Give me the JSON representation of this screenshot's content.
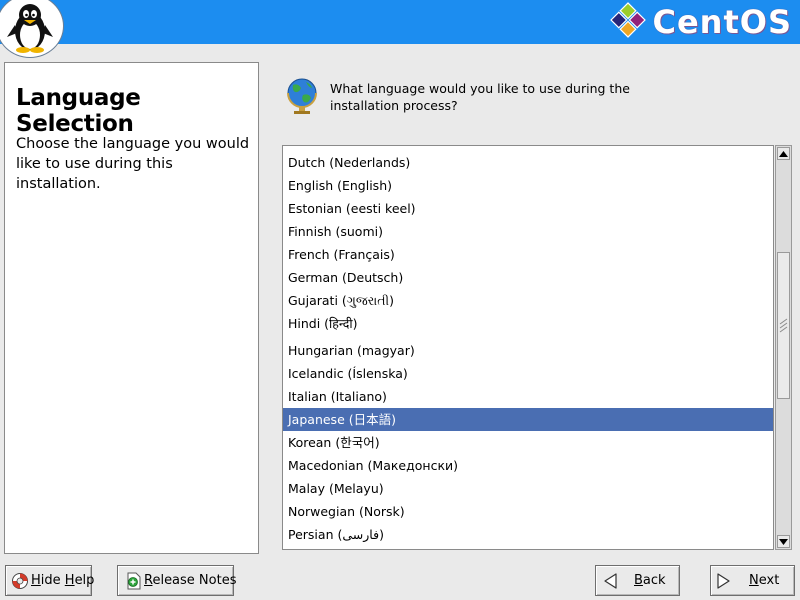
{
  "header": {
    "brand": "CentOS",
    "colors": {
      "bar": "#1c8df0",
      "selection": "#4a6eb2"
    }
  },
  "help": {
    "title": "Language Selection",
    "body": "Choose the language you would like to use during this installation."
  },
  "prompt": {
    "question": "What language would you like to use during the installation process?"
  },
  "languages": {
    "items": [
      "Dutch (Nederlands)",
      "English (English)",
      "Estonian (eesti keel)",
      "Finnish (suomi)",
      "French (Français)",
      "German (Deutsch)",
      "Gujarati (ગુજરાતી)",
      "Hindi (हिन्दी)",
      "Hungarian (magyar)",
      "Icelandic (Íslenska)",
      "Italian (Italiano)",
      "Japanese (日本語)",
      "Korean (한국어)",
      "Macedonian (Македонски)",
      "Malay (Melayu)",
      "Norwegian (Norsk)",
      "Persian (فارسی)"
    ],
    "selected": "Japanese (日本語)"
  },
  "buttons": {
    "hide_help": {
      "mnemonic": "H",
      "rest": "ide ",
      "mnemonic2": "H",
      "rest2": "elp"
    },
    "release_notes": {
      "mnemonic": "R",
      "rest": "elease Notes"
    },
    "back": {
      "mnemonic": "B",
      "rest": "ack"
    },
    "next": {
      "mnemonic": "N",
      "rest": "ext"
    }
  },
  "icons": {
    "header_logo": "tux-penguin-icon",
    "brand_logo": "centos-logo-icon",
    "globe": "globe-icon",
    "hide_help": "lifebuoy-icon",
    "release_notes": "document-add-icon",
    "back": "arrow-left-icon",
    "next": "arrow-right-icon"
  }
}
